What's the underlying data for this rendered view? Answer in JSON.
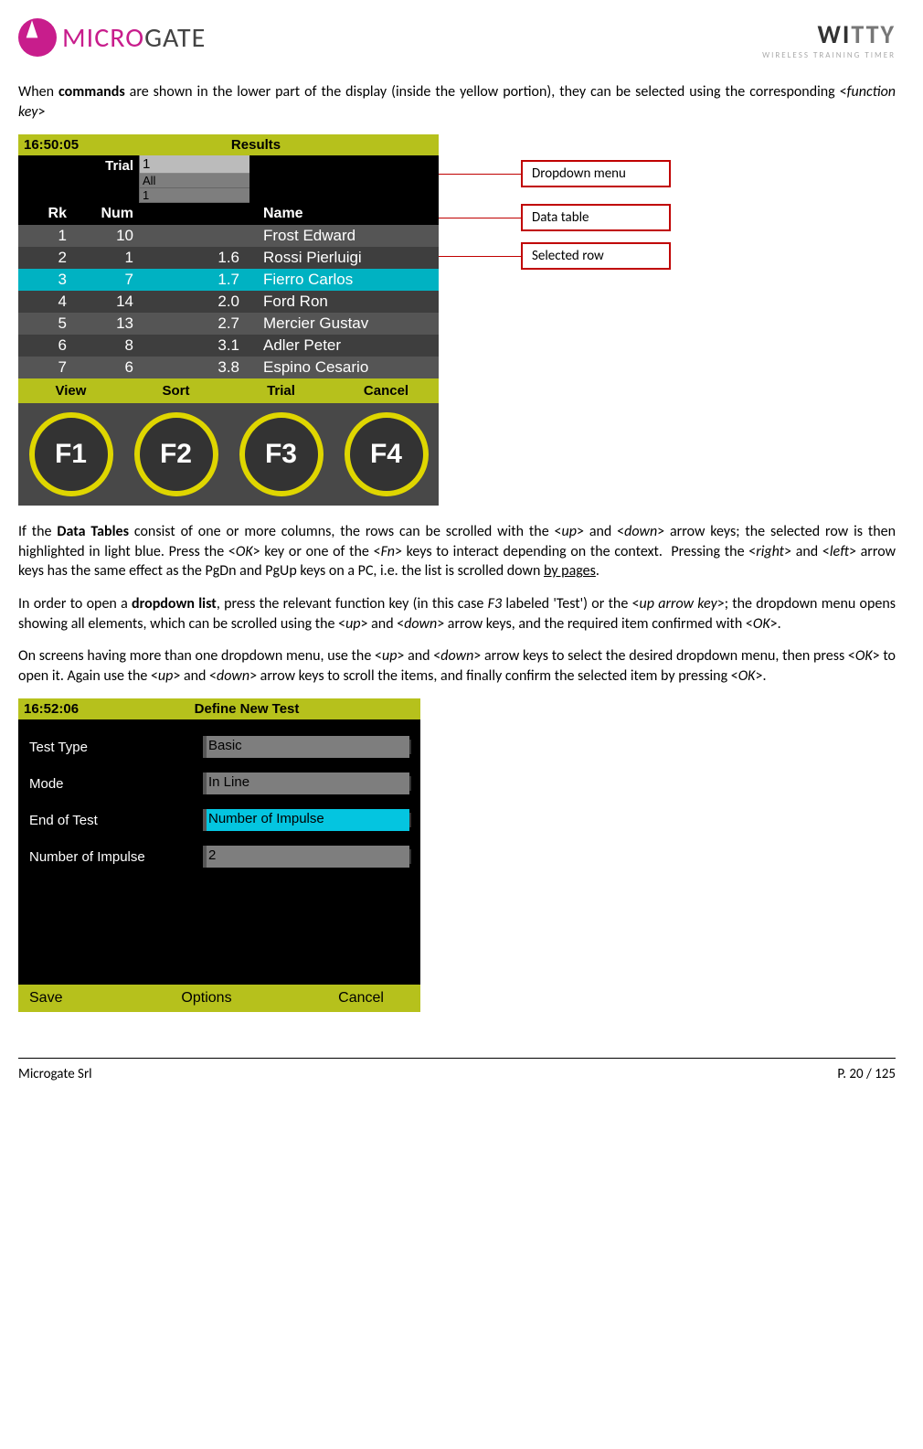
{
  "header": {
    "brand_a": "MICRO",
    "brand_b": "GATE",
    "witty_a": "WI",
    "witty_b": "TTY",
    "tagline": "WIRELESS TRAINING TIMER"
  },
  "p1_a": "When ",
  "p1_b": "commands",
  "p1_c": " are shown in the lower part of the display (inside the yellow portion), they can be selected using the corresponding <",
  "p1_d": "function key",
  "p1_e": ">",
  "s1": {
    "time": "16:50:05",
    "title": "Results",
    "trial_lbl": "Trial",
    "dd": {
      "sel": "1",
      "o1": "All",
      "o2": "1"
    },
    "cols": {
      "rk": "Rk",
      "num": "Num",
      "gap": "",
      "name": "Name"
    },
    "rows": [
      {
        "rk": "1",
        "num": "10",
        "gap": "",
        "name": "Frost Edward",
        "sel": false,
        "cls": "r-even"
      },
      {
        "rk": "2",
        "num": "1",
        "gap": "1.6",
        "name": "Rossi Pierluigi",
        "sel": false,
        "cls": "r-odd"
      },
      {
        "rk": "3",
        "num": "7",
        "gap": "1.7",
        "name": "Fierro Carlos",
        "sel": true,
        "cls": "r-sel"
      },
      {
        "rk": "4",
        "num": "14",
        "gap": "2.0",
        "name": "Ford Ron",
        "sel": false,
        "cls": "r-odd"
      },
      {
        "rk": "5",
        "num": "13",
        "gap": "2.7",
        "name": "Mercier Gustav",
        "sel": false,
        "cls": "r-even"
      },
      {
        "rk": "6",
        "num": "8",
        "gap": "3.1",
        "name": "Adler Peter",
        "sel": false,
        "cls": "r-odd"
      },
      {
        "rk": "7",
        "num": "6",
        "gap": "3.8",
        "name": "Espino Cesario",
        "sel": false,
        "cls": "r-even"
      }
    ],
    "cmds": {
      "c1": "View",
      "c2": "Sort",
      "c3": "Trial",
      "c4": "Cancel"
    },
    "f": {
      "f1": "F1",
      "f2": "F2",
      "f3": "F3",
      "f4": "F4"
    }
  },
  "callouts": {
    "a": "Dropdown menu",
    "b": "Data table",
    "c": "Selected row"
  },
  "p2": "If the <b>Data Tables</b> consist of one or more columns, the rows can be scrolled with the &lt;<em>up</em>&gt; and &lt;<em>down</em>&gt; arrow keys; the selected row is then highlighted in light blue. Press the &lt;<em>OK</em>&gt; key or one of the &lt;<em>Fn</em>&gt; keys to interact depending on the context.&nbsp; Pressing the &lt;<em>right</em>&gt; and &lt;<em>left</em>&gt; arrow keys has the same effect as the PgDn and PgUp keys on a PC, i.e. the list is scrolled down <span class='underline'>by pages</span>.",
  "p3": "In order to open a <b>dropdown list</b>, press the relevant function key (in this case <em>F3</em> labeled 'Test') or the &lt;<em>up arrow key</em>&gt;; the dropdown menu opens showing all elements, which can be scrolled using the &lt;<em>up</em>&gt; and &lt;<em>down</em>&gt; arrow keys, and the required item confirmed with &lt;<em>OK</em>&gt;.",
  "p4": "On screens having more than one dropdown menu, use the &lt;<em>up</em>&gt; and &lt;<em>down</em>&gt; arrow keys to select the desired dropdown menu, then press &lt;<em>OK</em>&gt; to open it. Again use the &lt;<em>up</em>&gt; and &lt;<em>down</em>&gt; arrow keys to scroll the items, and finally confirm the selected item by pressing &lt;<em>OK</em>&gt;.",
  "s2": {
    "time": "16:52:06",
    "title": "Define New Test",
    "rows": [
      {
        "lbl": "Test Type",
        "val": "Basic",
        "sel": false
      },
      {
        "lbl": "Mode",
        "val": "In Line",
        "sel": false
      },
      {
        "lbl": "End of Test",
        "val": "Number of Impulse",
        "sel": true
      },
      {
        "lbl": "Number of Impulse",
        "val": "2",
        "sel": false
      }
    ],
    "cmds": {
      "c1": "Save",
      "c2": "Options",
      "c3": "Cancel"
    }
  },
  "footer": {
    "left": "Microgate Srl",
    "right": "P. 20 / 125"
  }
}
